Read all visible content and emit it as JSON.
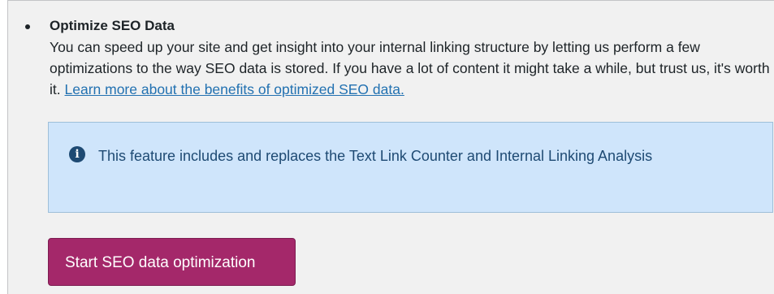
{
  "section": {
    "title": "Optimize SEO Data",
    "description": "You can speed up your site and get insight into your internal linking structure by letting us perform a few optimizations to the way SEO data is stored. If you have a lot of content it might take a while, but trust us, it's worth it.",
    "learn_more_link": "Learn more about the benefits of optimized SEO data."
  },
  "notice": {
    "icon": "info-icon",
    "text": "This feature includes and replaces the Text Link Counter and Internal Linking Analysis"
  },
  "actions": {
    "start_button": "Start SEO data optimization"
  },
  "colors": {
    "button": "#a4286a",
    "notice_bg": "#cfe5fb",
    "notice_text": "#1e4a73",
    "link": "#2271b1"
  }
}
